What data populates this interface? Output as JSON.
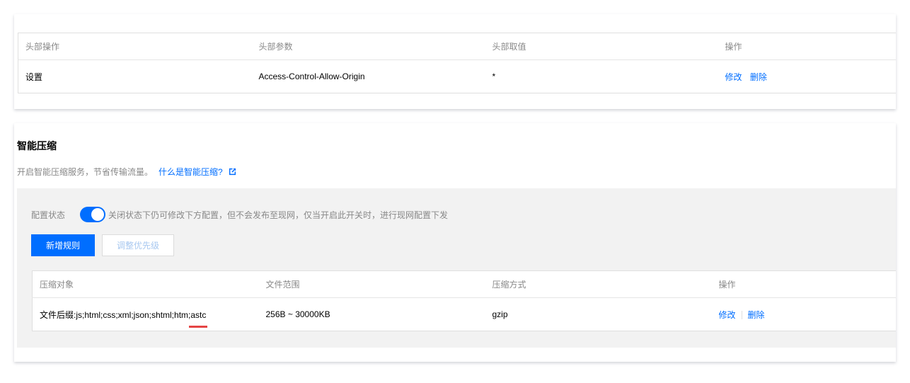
{
  "header_rules": {
    "columns": [
      "头部操作",
      "头部参数",
      "头部取值",
      "操作"
    ],
    "rows": [
      {
        "action": "设置",
        "param": "Access-Control-Allow-Origin",
        "value": "*",
        "edit": "修改",
        "delete": "删除"
      }
    ]
  },
  "smart_compression": {
    "title": "智能压缩",
    "description": "开启智能压缩服务，节省传输流量。",
    "help_link": "什么是智能压缩?",
    "status_label": "配置状态",
    "toggle_on": true,
    "status_hint": "关闭状态下仍可修改下方配置，但不会发布至现网，仅当开启此开关时，进行现网配置下发",
    "add_rule_button": "新增规则",
    "adjust_priority_button": "调整优先级",
    "columns": [
      "压缩对象",
      "文件范围",
      "压缩方式",
      "操作"
    ],
    "rows": [
      {
        "target": "文件后缀:js;html;css;xml;json;shtml;htm;astc",
        "range": "256B ~ 30000KB",
        "method": "gzip",
        "edit": "修改",
        "delete": "删除"
      }
    ]
  },
  "colors": {
    "primary": "#006eff",
    "highlight_underline": "#e54545"
  }
}
